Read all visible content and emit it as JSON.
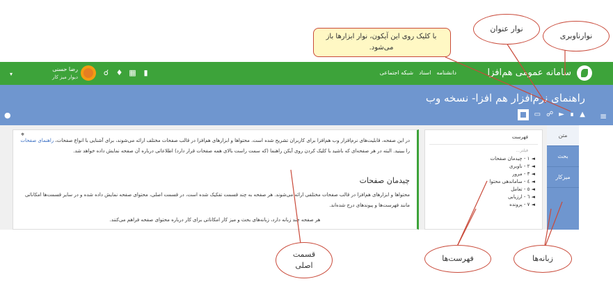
{
  "navbar": {
    "title": "سامانه عمومی هم‌افزا",
    "links": [
      "دانشنامه",
      "اسناد",
      "شبکه اجتماعی"
    ],
    "user_name": "رضا حسنی",
    "user_sub": "دیوار   میز کار"
  },
  "titlebar": {
    "title": "راهنمای نرم‌افزار هم افزا- نسخه وب"
  },
  "tabs": [
    "متن",
    "بحث",
    "میزکار"
  ],
  "toc": {
    "title": "فهرست",
    "search_hint": "فیلتر...",
    "items": [
      "◄ ۱ - چیدمان صفحات",
      "◄ ۲ - ناوبری",
      "◄ ۳ - مرور",
      "◄ ٤ - ساماندهی محتوا",
      "◄ ٥ - تعامل",
      "◄ ٦ - ارزیابی",
      "◄ ۷ - پرونده"
    ]
  },
  "main": {
    "para1_a": "در این صفحه، قابلیت‌های نرم‌افزار وب هم‌افزا برای کاربران تشریح شده است. محتواها و ابزارهای هم‌افزا در قالب صفحات مختلف ارائه می‌شوند، برای آشنایی با انواع صفحات،",
    "para1_link": "راهنمای صفحات",
    "para1_b": "را ببینید. البته در هر صفحه‌ای که باشید با کلیک کردن روی آیکن راهنما (که سمت راست بالای همه صفحات قرار دارد) اطلاعاتی درباره آن صفحه نمایش داده خواهد شد.",
    "heading": "چیدمان صفحات",
    "para2": "محتواها و ابزارهای هم‌افزا در قالب صفحات مختلفی ارائه می‌شوند. هر صفحه به چند قسمت تفکیک شده است، در قسمت اصلی، محتوای صفحه نمایش داده شده و در سایر قسمت‌ها امکاناتی مانند فهرست‌ها و پیوندهای درج شده‌اند.",
    "para3": "هر صفحه چند زبانه دارد، زبانه‌های بحث و میز کار امکاناتی برای کار درباره محتوای صفحه فراهم می‌کنند."
  },
  "annotations": {
    "callout": "با کلیک روی این آیکون، نوار ابزارها باز می‌شود.",
    "title_bar": "نوار عنوان",
    "nav_bar": "نوارناوبری",
    "main_part": "قسمت اصلی",
    "lists": "فهرست‌ها",
    "tabs": "زبانه‌ها"
  },
  "colors": {
    "navbar": "#3da33a",
    "titlebar": "#6f96cf",
    "annotation": "#c94a3a"
  }
}
